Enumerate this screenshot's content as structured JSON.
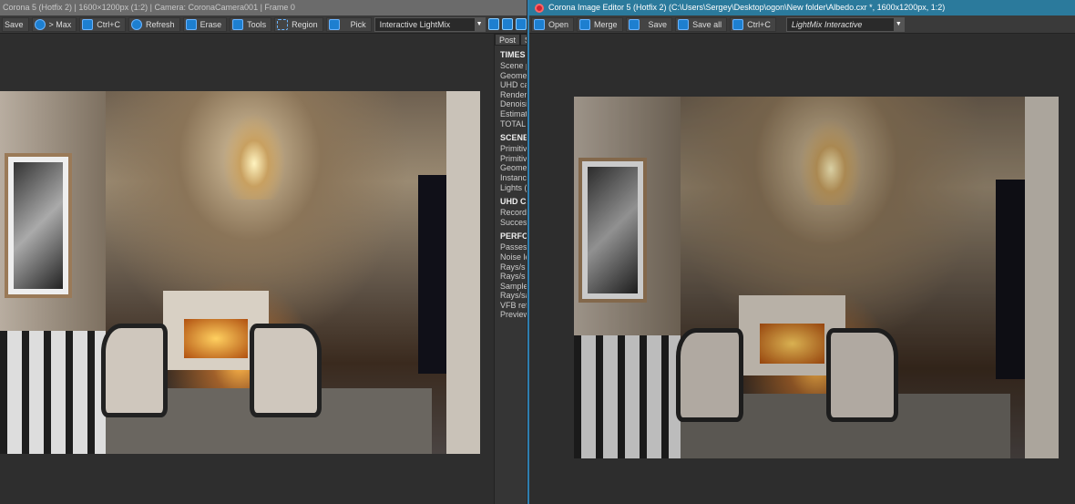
{
  "vfb": {
    "title": "Corona 5 (Hotfix 2) | 1600×1200px (1:2) | Camera: CoronaCamera001 | Frame 0",
    "toolbar": {
      "save": "Save",
      "max": "> Max",
      "copy": "Ctrl+C",
      "refresh": "Refresh",
      "erase": "Erase",
      "tools": "Tools",
      "region": "Region",
      "pick": "Pick",
      "dropdown": "Interactive LightMix"
    },
    "panel": {
      "tabs": [
        "Post",
        "S"
      ],
      "sections": [
        {
          "title": "TIMES",
          "rows": [
            "Scene pa",
            "Geometr",
            "UHD cac",
            "Renderin",
            "Denoisin",
            "Estimate",
            "TOTAL e"
          ]
        },
        {
          "title": "SCENE",
          "rows": [
            "Primitive",
            "Primitive",
            "Geometr",
            "Instance",
            "Lights (g"
          ]
        },
        {
          "title": "UHD CA",
          "rows": [
            "Records:",
            "Success"
          ]
        },
        {
          "title": "PERFOR",
          "rows": [
            "Passes to",
            "Noise lev",
            "Rays/s to",
            "Rays/s a",
            "Samples",
            "Rays/sar",
            "VFB refre",
            "Preview"
          ]
        }
      ]
    }
  },
  "cie": {
    "title": "Corona Image Editor 5 (Hotfix 2) (C:\\Users\\Sergey\\Desktop\\ogon\\New folder\\Albedo.cxr *, 1600x1200px, 1:2)",
    "toolbar": {
      "open": "Open",
      "merge": "Merge",
      "save": "Save",
      "save_all": "Save all",
      "copy": "Ctrl+C",
      "dropdown": "LightMix Interactive"
    }
  },
  "colors": {
    "accent": "#1d7fd0",
    "cie_titlebar": "#2b7a9c"
  }
}
